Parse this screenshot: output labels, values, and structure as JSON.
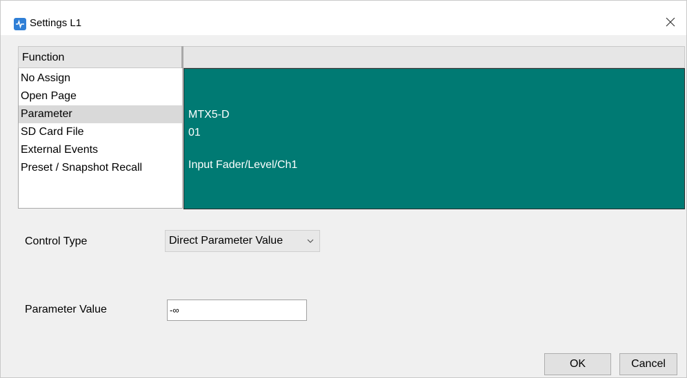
{
  "window": {
    "title": "Settings L1"
  },
  "function_list": {
    "header": "Function",
    "items": [
      {
        "label": "No Assign",
        "selected": false
      },
      {
        "label": "Open Page",
        "selected": false
      },
      {
        "label": "Parameter",
        "selected": true
      },
      {
        "label": "SD Card File",
        "selected": false
      },
      {
        "label": "External Events",
        "selected": false
      },
      {
        "label": "Preset / Snapshot Recall",
        "selected": false
      }
    ]
  },
  "detail": {
    "device": "MTX5-D",
    "id": "01",
    "parameter": "Input Fader/Level/Ch1",
    "panel_color": "#007a73"
  },
  "control_type": {
    "label": "Control Type",
    "value": "Direct Parameter Value"
  },
  "parameter_value": {
    "label": "Parameter Value",
    "value": "-∞"
  },
  "buttons": {
    "ok": "OK",
    "cancel": "Cancel"
  }
}
